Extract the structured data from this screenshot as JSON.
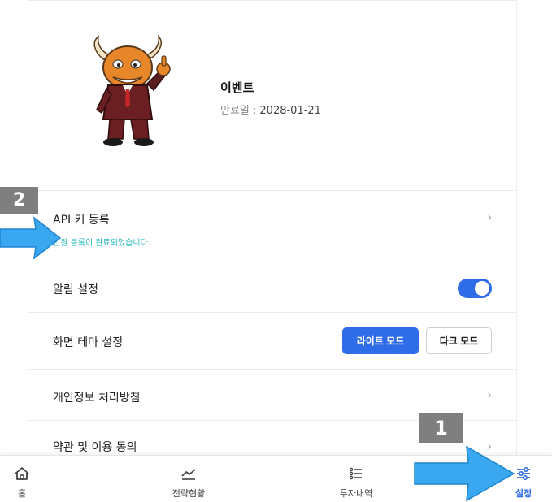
{
  "profile": {
    "event_name": "이벤트",
    "expiry_label": "만료일 :",
    "expiry_date": "2028-01-21"
  },
  "settings": {
    "api_key_label": "API 키 등록",
    "api_key_sub": "인원 등록이 완료되었습니다.",
    "alarm_label": "알림 설정",
    "alarm_on": true,
    "theme_label": "화면 테마 설정",
    "light_mode": "라이트 모드",
    "dark_mode": "다크 모드",
    "privacy_label": "개인정보 처리방침",
    "terms_label": "약관 및 이용 동의"
  },
  "tabbar": {
    "home": "홈",
    "strategy": "전략현황",
    "history": "투자내역",
    "settings": "설정"
  },
  "annotations": {
    "badge_1": "1",
    "badge_2": "2"
  },
  "colors": {
    "accent": "#2f6ce8",
    "success_text": "#22b8b8",
    "annotation_arrow": "#3aa8f0",
    "annotation_badge": "#7f7f7f"
  }
}
